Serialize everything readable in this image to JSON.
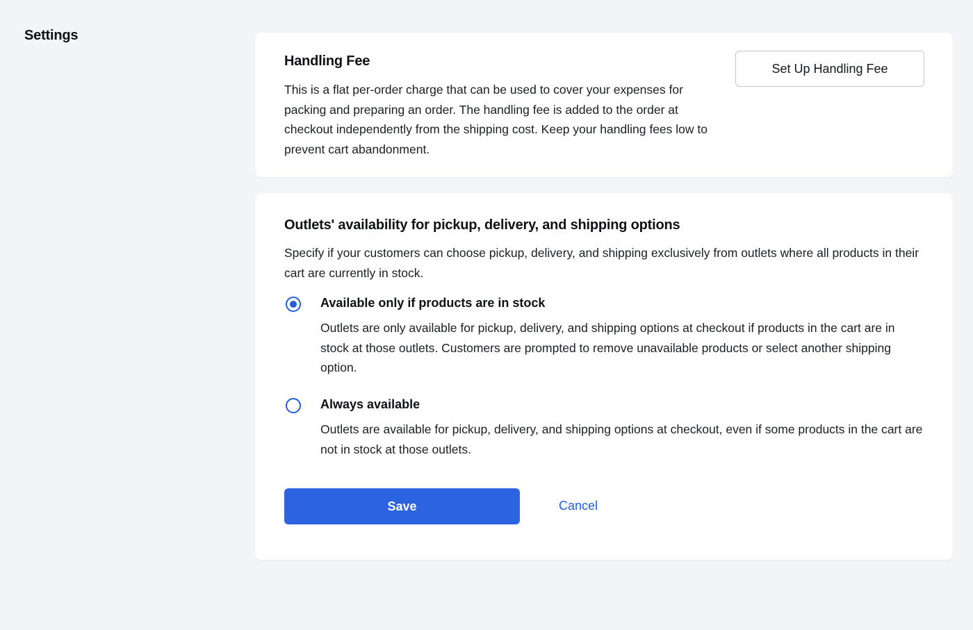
{
  "page": {
    "title": "Settings"
  },
  "handling_fee": {
    "title": "Handling Fee",
    "description": "This is a flat per-order charge that can be used to cover your expenses for packing and preparing an order. The handling fee is added to the order at checkout independently from the shipping cost. Keep your handling fees low to prevent cart abandonment.",
    "setup_button_label": "Set Up Handling Fee"
  },
  "outlets": {
    "title": "Outlets' availability for pickup, delivery, and shipping options",
    "description": "Specify if your customers can choose pickup, delivery, and shipping exclusively from outlets where all products in their cart are currently in stock.",
    "options": [
      {
        "label": "Available only if products are in stock",
        "description": "Outlets are only available for pickup, delivery, and shipping options at checkout if products in the cart are in stock at those outlets. Customers are prompted to remove unavailable products or select another shipping option.",
        "selected": true
      },
      {
        "label": "Always available",
        "description": "Outlets are available for pickup, delivery, and shipping options at checkout, even if some products in the cart are not in stock at those outlets.",
        "selected": false
      }
    ],
    "save_label": "Save",
    "cancel_label": "Cancel"
  },
  "colors": {
    "background": "#f3f4f8",
    "card": "#ffffff",
    "accent": "#2b63e0",
    "link": "#1f5fd6"
  }
}
